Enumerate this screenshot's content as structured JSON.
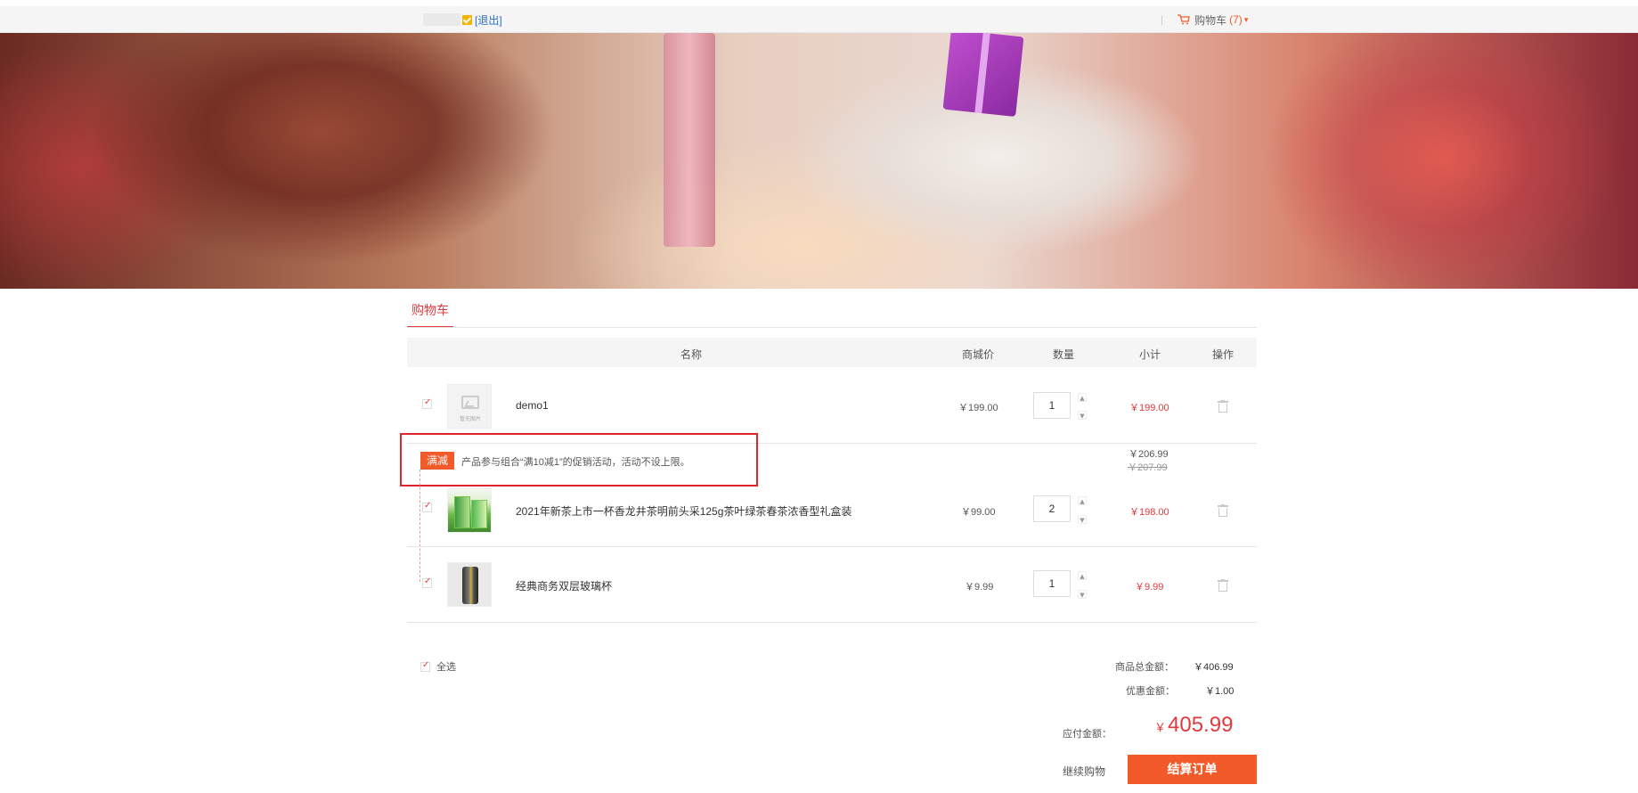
{
  "topbar": {
    "logout_label": "[退出]",
    "cart_label": "购物车",
    "cart_count": "(7)",
    "separator": "|"
  },
  "cart": {
    "tab_title": "购物车",
    "columns": {
      "name": "名称",
      "mall_price": "商城价",
      "quantity": "数量",
      "subtotal": "小计",
      "action": "操作"
    },
    "items": [
      {
        "name": "demo1",
        "thumb_text": "暂无图片",
        "price": "￥199.00",
        "quantity": "1",
        "subtotal": "￥199.00",
        "checked": true
      },
      {
        "name": "2021年新茶上市一杯香龙井茶明前头采125g茶叶绿茶春茶浓香型礼盒装",
        "price": "￥99.00",
        "quantity": "2",
        "subtotal": "￥198.00",
        "checked": true
      },
      {
        "name": "经典商务双层玻璃杯",
        "price": "￥9.99",
        "quantity": "1",
        "subtotal": "￥9.99",
        "checked": true
      }
    ],
    "promo": {
      "tag": "满减",
      "text": "产品参与组合“满10减1”的促销活动，活动不设上限。",
      "price_now": "￥206.99",
      "price_old": "￥207.99"
    },
    "footer": {
      "select_all": "全选",
      "total_label": "商品总金额：",
      "total_value": "￥406.99",
      "discount_label": "优惠金额：",
      "discount_value": "￥1.00",
      "payable_label": "应付金额：",
      "payable_yen": "￥",
      "payable_value": "405.99",
      "continue_shopping": "继续购物",
      "checkout": "结算订单"
    }
  },
  "colors": {
    "accent": "#e4393c",
    "button": "#f25a2a",
    "highlight_box": "#e0242b"
  },
  "icons": {
    "cart": "cart-icon",
    "trash": "trash-icon",
    "placeholder": "image-placeholder-icon"
  }
}
